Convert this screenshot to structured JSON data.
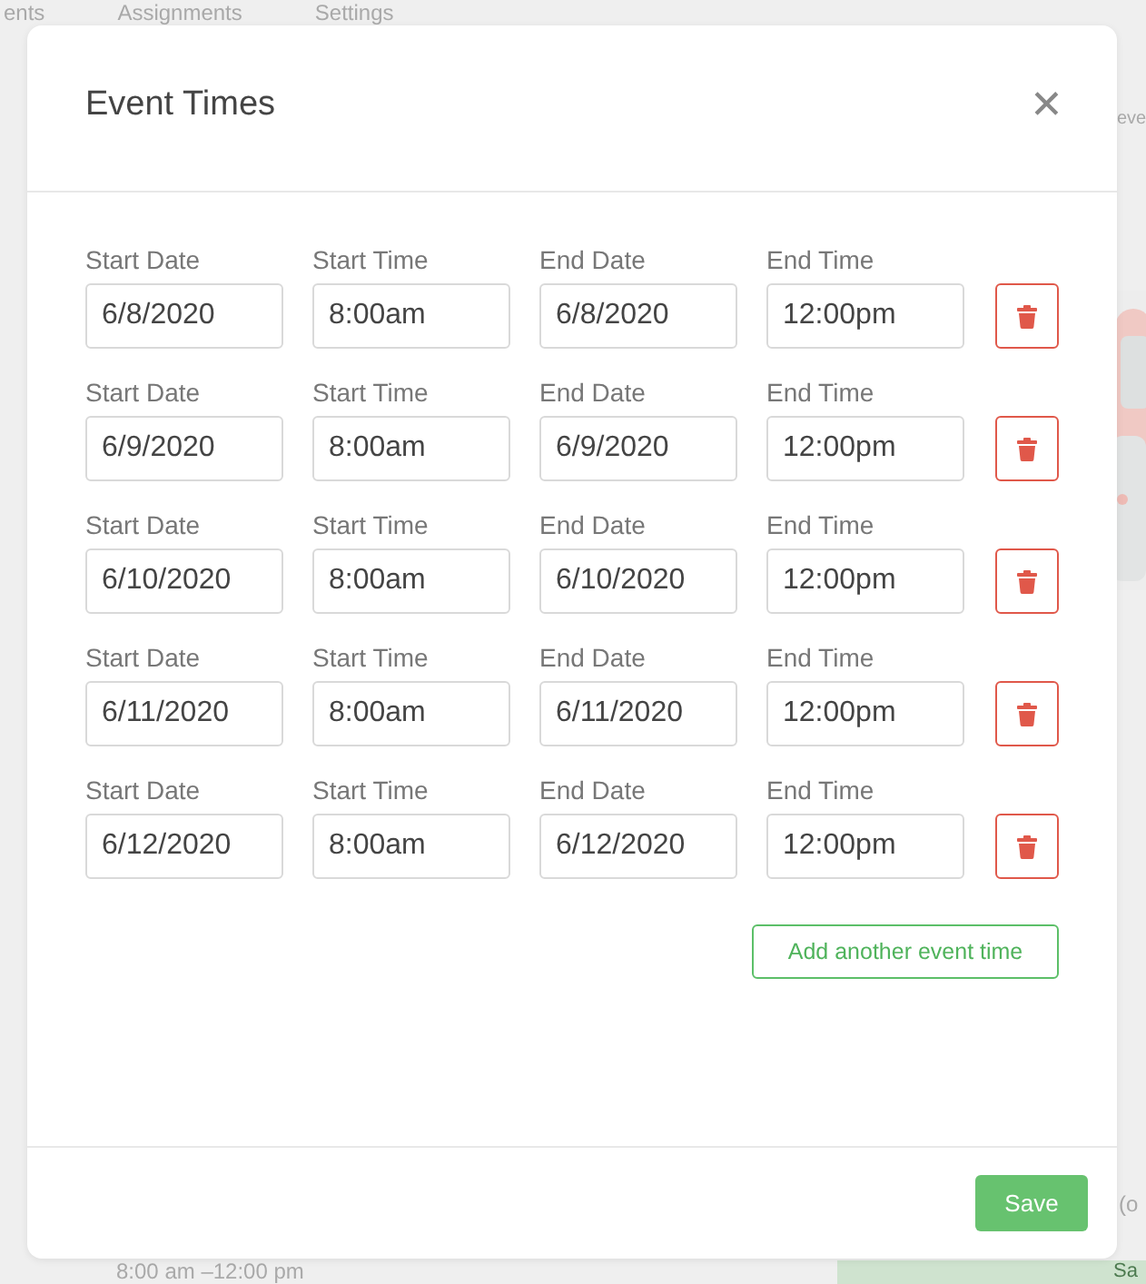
{
  "background": {
    "tabs": [
      {
        "label": "ents"
      },
      {
        "label": "Assignments"
      },
      {
        "label": "Settings"
      }
    ],
    "fragments": [
      "eve",
      "(o"
    ],
    "time_range": "8:00 am –12:00 pm",
    "button": "Sa",
    "picture": {
      "kind": "picture"
    }
  },
  "modal": {
    "title": "Event Times",
    "close": "✕",
    "rows": [
      {
        "labels": [
          "Start Date",
          "Start Time",
          "End Date",
          "End Time"
        ],
        "start_date": "6/8/2020",
        "start_time": "8:00am",
        "end_date": "6/8/2020",
        "end_time": "12:00pm"
      },
      {
        "labels": [
          "Start Date",
          "Start Time",
          "End Date",
          "End Time"
        ],
        "start_date": "6/9/2020",
        "start_time": "8:00am",
        "end_date": "6/9/2020",
        "end_time": "12:00pm"
      },
      {
        "labels": [
          "Start Date",
          "Start Time",
          "End Date",
          "End Time"
        ],
        "start_date": "6/10/2020",
        "start_time": "8:00am",
        "end_date": "6/10/2020",
        "end_time": "12:00pm"
      },
      {
        "labels": [
          "Start Date",
          "Start Time",
          "End Date",
          "End Time"
        ],
        "start_date": "6/11/2020",
        "start_time": "8:00am",
        "end_date": "6/11/2020",
        "end_time": "12:00pm"
      },
      {
        "labels": [
          "Start Date",
          "Start Time",
          "End Date",
          "End Time"
        ],
        "start_date": "6/12/2020",
        "start_time": "8:00am",
        "end_date": "6/12/2020",
        "end_time": "12:00pm"
      }
    ],
    "add_button": "Add another event time",
    "save_button": "Save"
  }
}
